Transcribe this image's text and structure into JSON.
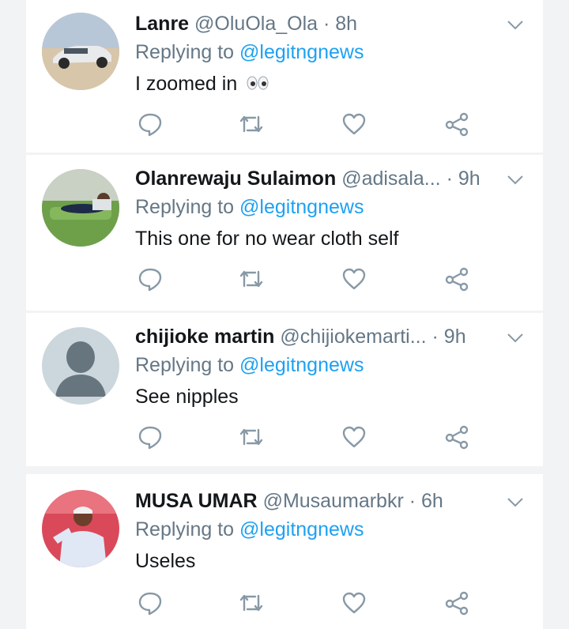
{
  "icons": {
    "reply": "reply-icon",
    "retweet": "retweet-icon",
    "like": "like-icon",
    "share": "share-icon",
    "caret": "chevron-down-icon"
  },
  "colors": {
    "name": "#14171a",
    "muted": "#657786",
    "link": "#1da1f2",
    "background": "#f2f3f4"
  },
  "tweets": [
    {
      "name": "Lanre",
      "handle": "@OluOla_Ola",
      "separator": "·",
      "time": "8h",
      "replying_prefix": "Replying to",
      "replying_to": "@legitngnews",
      "text": "I zoomed in",
      "emoji": "eyes"
    },
    {
      "name": "Olanrewaju Sulaimon",
      "handle": "@adisala...",
      "separator": "·",
      "time": "9h",
      "replying_prefix": "Replying to",
      "replying_to": "@legitngnews",
      "text": "This one for no wear cloth self"
    },
    {
      "name": "chijioke martin",
      "handle": "@chijiokemarti...",
      "separator": "·",
      "time": "9h",
      "replying_prefix": "Replying to",
      "replying_to": "@legitngnews",
      "text": "See nipples"
    },
    {
      "name": "MUSA UMAR",
      "handle": "@Musaumarbkr",
      "separator": "·",
      "time": "6h",
      "replying_prefix": "Replying to",
      "replying_to": "@legitngnews",
      "text": "Useles"
    }
  ]
}
